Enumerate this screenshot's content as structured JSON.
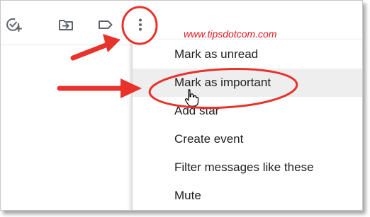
{
  "watermark": "www.tipsdotcom.com",
  "toolbar": {
    "icons": [
      "add-to-tasks-icon",
      "move-to-icon",
      "label-icon",
      "more-vertical-icon"
    ]
  },
  "menu": {
    "items": [
      {
        "label": "Mark as unread"
      },
      {
        "label": "Mark as important"
      },
      {
        "label": "Add star"
      },
      {
        "label": "Create event"
      },
      {
        "label": "Filter messages like these"
      },
      {
        "label": "Mute"
      }
    ]
  },
  "colors": {
    "annotation_red": "#e8322c",
    "watermark_red": "#e3161c",
    "icon_gray": "#5f6368",
    "hover_bg": "#eeeeee"
  }
}
